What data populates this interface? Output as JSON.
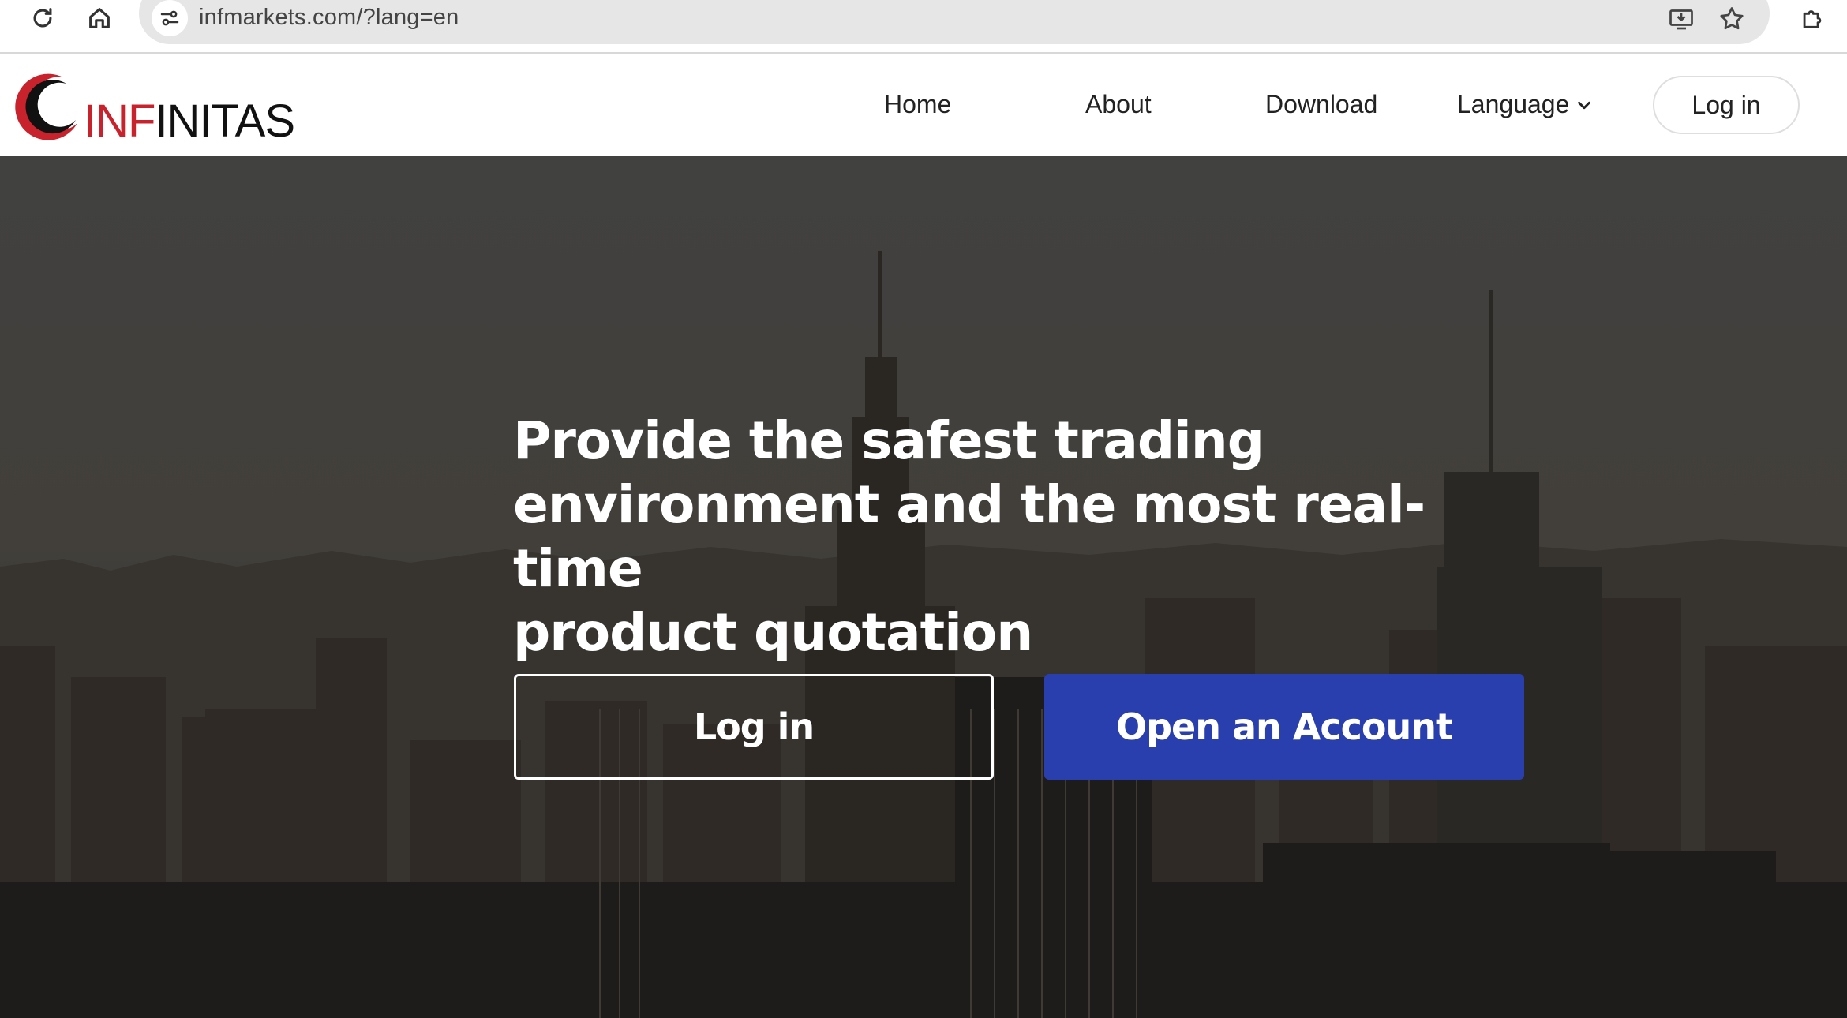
{
  "browser": {
    "url": "infmarkets.com/?lang=en",
    "icons": [
      "reload-icon",
      "home-icon",
      "site-info-icon",
      "install-app-icon",
      "bookmark-star-icon",
      "extensions-icon"
    ]
  },
  "navbar": {
    "logo": {
      "accent": "INF",
      "rest": "INITAS",
      "accent_color": "#c8232c"
    },
    "links": {
      "home": "Home",
      "about": "About",
      "download": "Download",
      "language": "Language"
    },
    "login": "Log in"
  },
  "hero": {
    "headline_lines": [
      "Provide the safest trading",
      "environment and the most real-time",
      "product quotation"
    ],
    "login_button": "Log in",
    "open_account_button": "Open an Account",
    "primary_color": "#2a3fae"
  }
}
